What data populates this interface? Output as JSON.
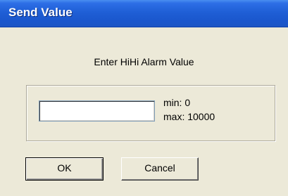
{
  "window": {
    "title": "Send Value"
  },
  "dialog": {
    "prompt": "Enter HiHi Alarm Value",
    "input": {
      "value": "",
      "placeholder": ""
    },
    "range": {
      "min_label": "min: 0",
      "max_label": "max: 10000"
    },
    "buttons": {
      "ok_label": "OK",
      "cancel_label": "Cancel"
    }
  },
  "colors": {
    "titlebar": "#1f5fd6",
    "dialog_background": "#ece9d8",
    "title_text": "#ffffff"
  }
}
